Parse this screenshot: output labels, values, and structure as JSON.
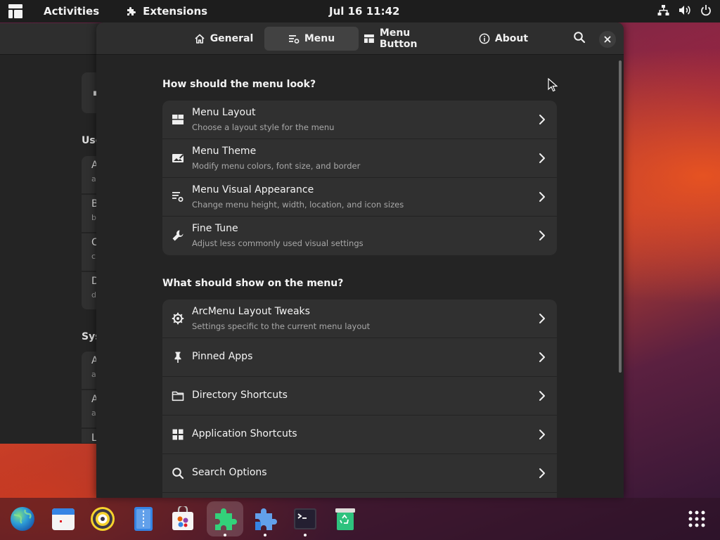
{
  "topbar": {
    "activities": "Activities",
    "extensions": "Extensions",
    "clock": "Jul 16  11:42",
    "icons": [
      "network-icon",
      "volume-icon",
      "power-icon"
    ]
  },
  "tabs": [
    {
      "label": "General",
      "icon": "home-icon",
      "active": false
    },
    {
      "label": "Menu",
      "icon": "menu-settings-icon",
      "active": true
    },
    {
      "label": "Menu Button",
      "icon": "menu-button-icon",
      "active": false
    },
    {
      "label": "About",
      "icon": "info-icon",
      "active": false
    }
  ],
  "header_icons": [
    "search-icon",
    "close-icon"
  ],
  "sections": [
    {
      "title": "How should the menu look?",
      "rows": [
        {
          "title": "Menu Layout",
          "subtitle": "Choose a layout style for the menu",
          "icon": "layout-icon"
        },
        {
          "title": "Menu Theme",
          "subtitle": "Modify menu colors, font size, and border",
          "icon": "theme-icon"
        },
        {
          "title": "Menu Visual Appearance",
          "subtitle": "Change menu height, width, location, and icon sizes",
          "icon": "visual-appearance-icon"
        },
        {
          "title": "Fine Tune",
          "subtitle": "Adjust less commonly used visual settings",
          "icon": "wrench-icon"
        }
      ]
    },
    {
      "title": "What should show on the menu?",
      "rows": [
        {
          "title": "ArcMenu Layout Tweaks",
          "subtitle": "Settings specific to the current menu layout",
          "icon": "gear-icon"
        },
        {
          "title": "Pinned Apps",
          "subtitle": "",
          "icon": "pin-icon"
        },
        {
          "title": "Directory Shortcuts",
          "subtitle": "",
          "icon": "folder-icon"
        },
        {
          "title": "Application Shortcuts",
          "subtitle": "",
          "icon": "app-grid-icon"
        },
        {
          "title": "Search Options",
          "subtitle": "",
          "icon": "search-icon"
        }
      ]
    }
  ],
  "background_window": {
    "section_labels": [
      "Use",
      "Sys"
    ],
    "rows": [
      {
        "title": "A",
        "subtitle": "a"
      },
      {
        "title": "B",
        "subtitle": "b"
      },
      {
        "title": "C",
        "subtitle": "c"
      },
      {
        "title": "D",
        "subtitle": "d"
      },
      {
        "title": "A",
        "subtitle": "a"
      },
      {
        "title": "A",
        "subtitle": "a"
      },
      {
        "title": "L",
        "subtitle": ""
      }
    ]
  },
  "dock": {
    "apps": [
      {
        "name": "web-browser",
        "running": false
      },
      {
        "name": "calendar",
        "running": false
      },
      {
        "name": "rhythmbox",
        "running": false
      },
      {
        "name": "text-editor",
        "running": false
      },
      {
        "name": "software-center",
        "running": false
      },
      {
        "name": "extensions",
        "running": true
      },
      {
        "name": "extension-manager",
        "running": true
      },
      {
        "name": "terminal",
        "running": true
      },
      {
        "name": "trash",
        "running": false
      }
    ],
    "show_apps": "show-apps"
  }
}
